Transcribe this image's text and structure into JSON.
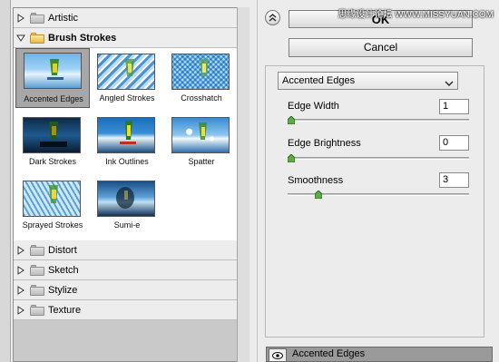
{
  "gallery": {
    "categories_top": [
      {
        "label": "Artistic",
        "expanded": false,
        "icon": "folder-icon"
      },
      {
        "label": "Brush Strokes",
        "expanded": true,
        "icon": "folder-open-icon"
      }
    ],
    "thumbnails": [
      {
        "label": "Accented Edges",
        "selected": true
      },
      {
        "label": "Angled Strokes",
        "selected": false
      },
      {
        "label": "Crosshatch",
        "selected": false
      },
      {
        "label": "Dark Strokes",
        "selected": false
      },
      {
        "label": "Ink Outlines",
        "selected": false
      },
      {
        "label": "Spatter",
        "selected": false
      },
      {
        "label": "Sprayed Strokes",
        "selected": false
      },
      {
        "label": "Sumi-e",
        "selected": false
      }
    ],
    "categories_bottom": [
      {
        "label": "Distort",
        "expanded": false,
        "icon": "folder-icon"
      },
      {
        "label": "Sketch",
        "expanded": false,
        "icon": "folder-icon"
      },
      {
        "label": "Stylize",
        "expanded": false,
        "icon": "folder-icon"
      },
      {
        "label": "Texture",
        "expanded": false,
        "icon": "folder-icon"
      }
    ]
  },
  "buttons": {
    "ok_label": "OK",
    "cancel_label": "Cancel"
  },
  "watermark": "思缘设计论坛  WWW.MISSYUAN.COM",
  "filter": {
    "selected": "Accented Edges",
    "params": [
      {
        "label": "Edge Width",
        "value": "1",
        "level": 0.0
      },
      {
        "label": "Edge Brightness",
        "value": "0",
        "level": 0.0
      },
      {
        "label": "Smoothness",
        "value": "3",
        "level": 0.15
      }
    ]
  },
  "layer": {
    "label": "Accented Edges",
    "icon": "eye-icon"
  },
  "colors": {
    "accent_blue": "#2f6fd0",
    "selected_bg": "#a7a7a7"
  }
}
